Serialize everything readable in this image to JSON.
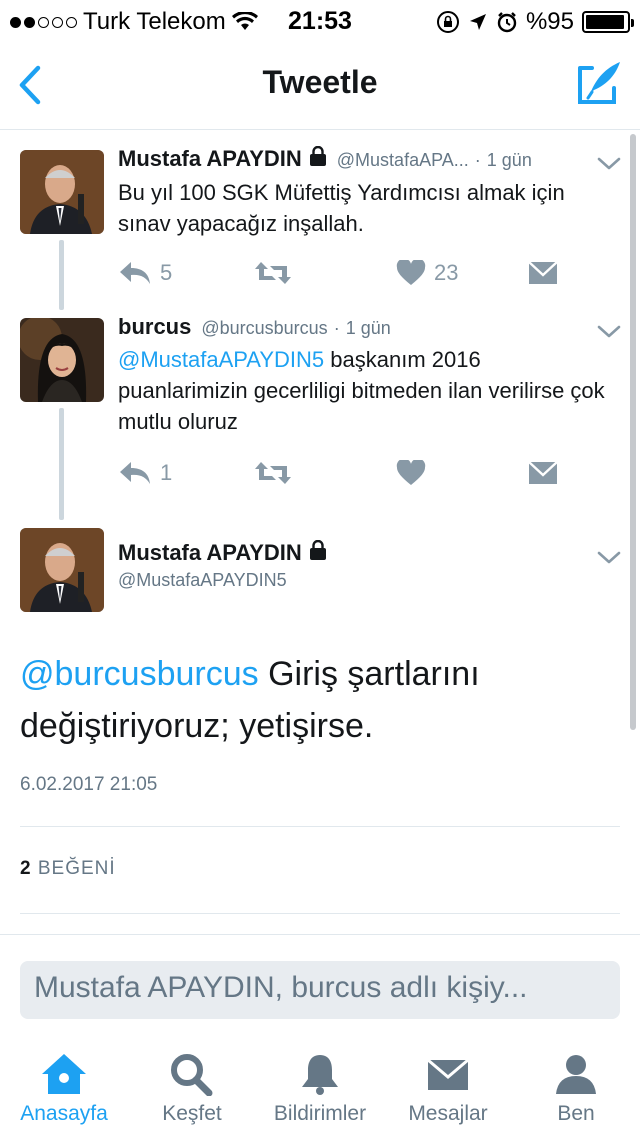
{
  "status_bar": {
    "carrier": "Turk Telekom",
    "time": "21:53",
    "battery": "%95",
    "signal_dots_filled": 2,
    "signal_dots_total": 5,
    "battery_level": 0.95
  },
  "nav": {
    "title": "Tweetle",
    "back_icon": "chevron-left-icon",
    "compose_icon": "compose-tweet-icon"
  },
  "tweets": [
    {
      "name": "Mustafa APAYDIN",
      "handle": "@MustafaAPA...",
      "time": "1 gün",
      "text": "Bu yıl 100 SGK Müfettiş Yardımcısı almak için sınav yapacağız inşallah.",
      "replies": "5",
      "likes": "23"
    },
    {
      "name": "burcus",
      "handle": "@burcusburcus",
      "time": "1 gün",
      "mention": "@MustafaAPAYDIN5",
      "text": " başkanım 2016 puanlarimizin gecerliligi bitmeden ilan verilirse çok mutlu oluruz",
      "replies": "1",
      "likes": ""
    }
  ],
  "main_tweet": {
    "name": "Mustafa APAYDIN",
    "handle": "@MustafaAPAYDIN5",
    "mention": "@burcusburcus",
    "text": " Giriş şartlarını değiştiriyoruz; yetişirse.",
    "date": "6.02.2017 21:05",
    "likes_count": "2",
    "likes_label": "BEĞENİ"
  },
  "reply": {
    "placeholder": "Mustafa APAYDIN, burcus adlı kişiy..."
  },
  "tabs": [
    {
      "label": "Anasayfa",
      "icon": "home-icon",
      "active": true
    },
    {
      "label": "Keşfet",
      "icon": "search-icon",
      "active": false
    },
    {
      "label": "Bildirimler",
      "icon": "bell-icon",
      "active": false
    },
    {
      "label": "Mesajlar",
      "icon": "envelope-icon",
      "active": false
    },
    {
      "label": "Ben",
      "icon": "person-icon",
      "active": false
    }
  ],
  "colors": {
    "accent": "#1da1f2",
    "secondary_text": "#657786",
    "icon_gray": "#8899a6"
  }
}
